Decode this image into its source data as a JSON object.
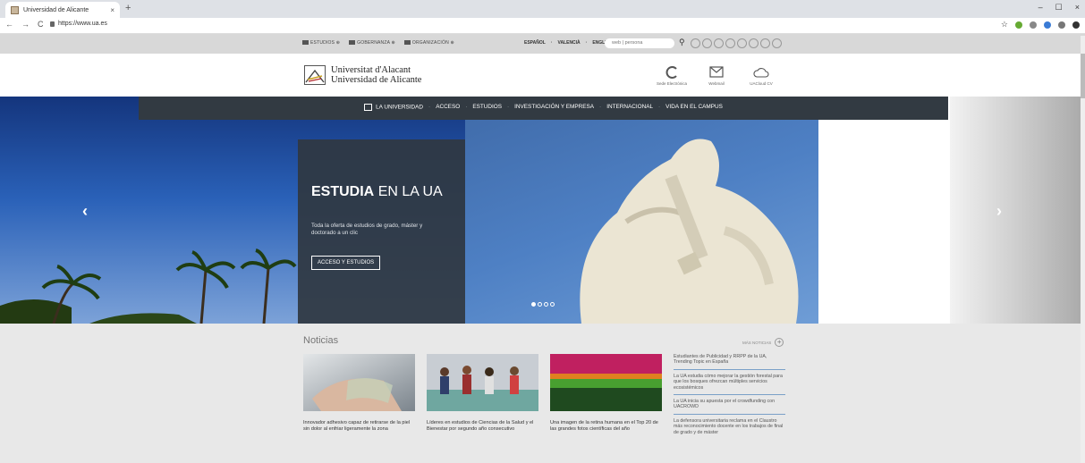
{
  "browser": {
    "tab_title": "Universidad de Alicante",
    "tab_close": "×",
    "new_tab": "+",
    "back": "←",
    "forward": "→",
    "reload": "C",
    "url": "https://www.ua.es",
    "win_min": "–",
    "win_max": "☐",
    "win_close": "×",
    "star": "☆"
  },
  "topbar": {
    "links": [
      "ESTUDIOS",
      "GOBERNANZA",
      "ORGANIZACIÓN"
    ],
    "languages": [
      "ESPAÑOL",
      "VALENCIÀ",
      "ENGLISH"
    ],
    "search_placeholder": "web | persona",
    "search_icon": "search-icon",
    "social_icons": [
      "facebook-icon",
      "twitter-icon",
      "youtube-icon",
      "instagram-icon",
      "linkedin-icon",
      "tiktok-icon",
      "pinterest-icon",
      "flickr-icon"
    ]
  },
  "header": {
    "logo_line1": "Universitat d'Alacant",
    "logo_line2": "Universidad de Alicante",
    "services": [
      {
        "label": "Sede Electrónica",
        "icon": "sede-icon"
      },
      {
        "label": "Webmail",
        "icon": "mail-icon"
      },
      {
        "label": "UACloud CV",
        "icon": "cloud-icon"
      }
    ]
  },
  "nav": {
    "items": [
      "LA UNIVERSIDAD",
      "ACCESO",
      "ESTUDIOS",
      "INVESTIGACIÓN Y EMPRESA",
      "INTERNACIONAL",
      "VIDA EN EL CAMPUS"
    ]
  },
  "hero": {
    "title_bold": "ESTUDIA",
    "title_rest": "EN LA UA",
    "subtitle": "Toda la oferta de estudios de grado, máster y doctorado a un clic",
    "button": "ACCESO Y ESTUDIOS",
    "prev": "‹",
    "next": "›",
    "slides": 4,
    "active_slide": 1
  },
  "news": {
    "heading": "Noticias",
    "more": "MÁS NOTICIAS",
    "cards": [
      {
        "caption": "Innovador adhesivo capaz de retirarse de la piel sin dolor al enfriar ligeramente la zona"
      },
      {
        "caption": "Líderes en estudios de Ciencias de la Salud y el Bienestar por segundo año consecutivo"
      },
      {
        "caption": "Una imagen de la retina humana en el Top 20 de las grandes fotos científicas del año"
      }
    ],
    "side": [
      "Estudiantes de Publicidad y RRPP de la UA, Trending Topic en España",
      "La UA estudia cómo mejorar la gestión forestal para que los bosques ofrezcan múltiples servicios ecosistémicos",
      "La UA inicia su apuesta por el crowdfunding con UACROWD",
      "La defensora universitaria reclama en el Claustro más reconocimiento docente en los trabajos de final de grado y de máster"
    ]
  }
}
